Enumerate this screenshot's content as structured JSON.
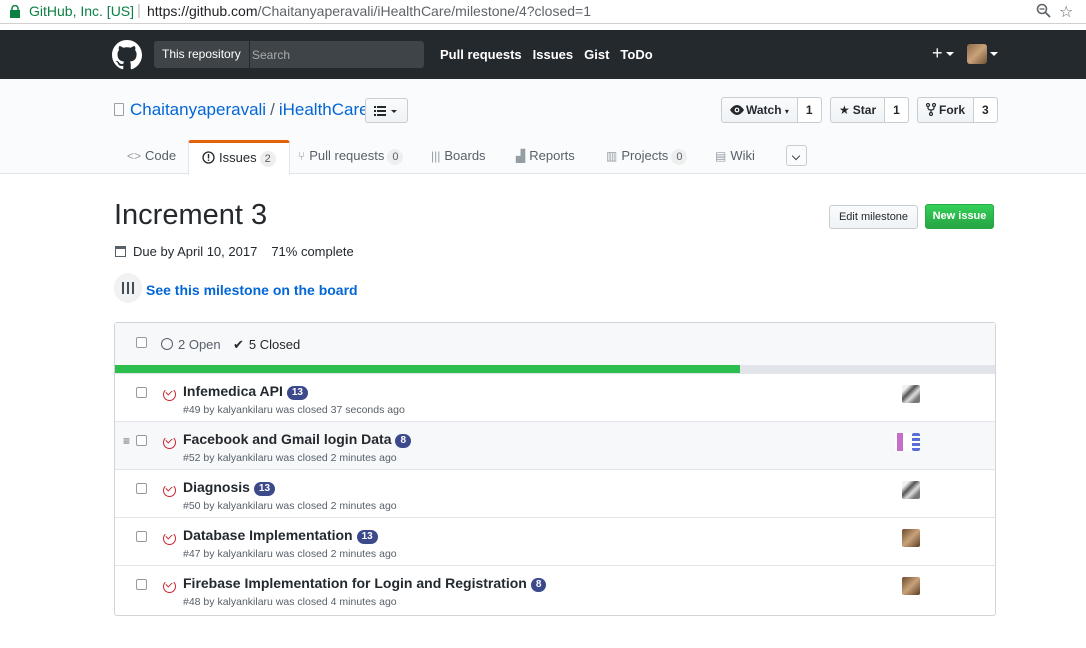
{
  "browser": {
    "site_identity": "GitHub, Inc. [US]",
    "url_prefix": "https://github.com",
    "url_path": "/Chaitanyaperavali/iHealthCare/milestone/4?closed=1"
  },
  "header": {
    "search_scope": "This repository",
    "search_placeholder": "Search",
    "nav": [
      "Pull requests",
      "Issues",
      "Gist",
      "ToDo"
    ],
    "plus": "+"
  },
  "repo": {
    "owner": "Chaitanyaperavali",
    "separator": "/",
    "name": "iHealthCare",
    "watch_label": "Watch",
    "watch_count": "1",
    "star_label": "Star",
    "star_count": "1",
    "fork_label": "Fork",
    "fork_count": "3"
  },
  "tabs": [
    {
      "label": "Code",
      "counter": ""
    },
    {
      "label": "Issues",
      "counter": "2"
    },
    {
      "label": "Pull requests",
      "counter": "0"
    },
    {
      "label": "Boards",
      "counter": ""
    },
    {
      "label": "Reports",
      "counter": ""
    },
    {
      "label": "Projects",
      "counter": "0"
    },
    {
      "label": "Wiki",
      "counter": ""
    }
  ],
  "milestone": {
    "title": "Increment 3",
    "due": "Due by April 10, 2017",
    "complete": "71% complete",
    "progress_fraction": 0.71,
    "board_link": "See this milestone on the board",
    "edit_button": "Edit milestone",
    "new_issue_button": "New issue"
  },
  "table": {
    "open_label": "2 Open",
    "closed_label": "5 Closed"
  },
  "issues": [
    {
      "title": "Infemedica API",
      "label": "13",
      "meta": "#49 by kalyankilaru was closed 37 seconds ago"
    },
    {
      "title": "Facebook and Gmail login Data",
      "label": "8",
      "meta": "#52 by kalyankilaru was closed 2 minutes ago"
    },
    {
      "title": "Diagnosis",
      "label": "13",
      "meta": "#50 by kalyankilaru was closed 2 minutes ago"
    },
    {
      "title": "Database Implementation",
      "label": "13",
      "meta": "#47 by kalyankilaru was closed 2 minutes ago"
    },
    {
      "title": "Firebase Implementation for Login and Registration",
      "label": "8",
      "meta": "#48 by kalyankilaru was closed 4 minutes ago"
    }
  ],
  "colors": {
    "header_bg": "#24292e",
    "link": "#0366d6",
    "progress_green": "#2cbe4e",
    "closed_red": "#cb2431",
    "label_blue": "#3c4a8c",
    "selected_tab_orange": "#e36209"
  }
}
